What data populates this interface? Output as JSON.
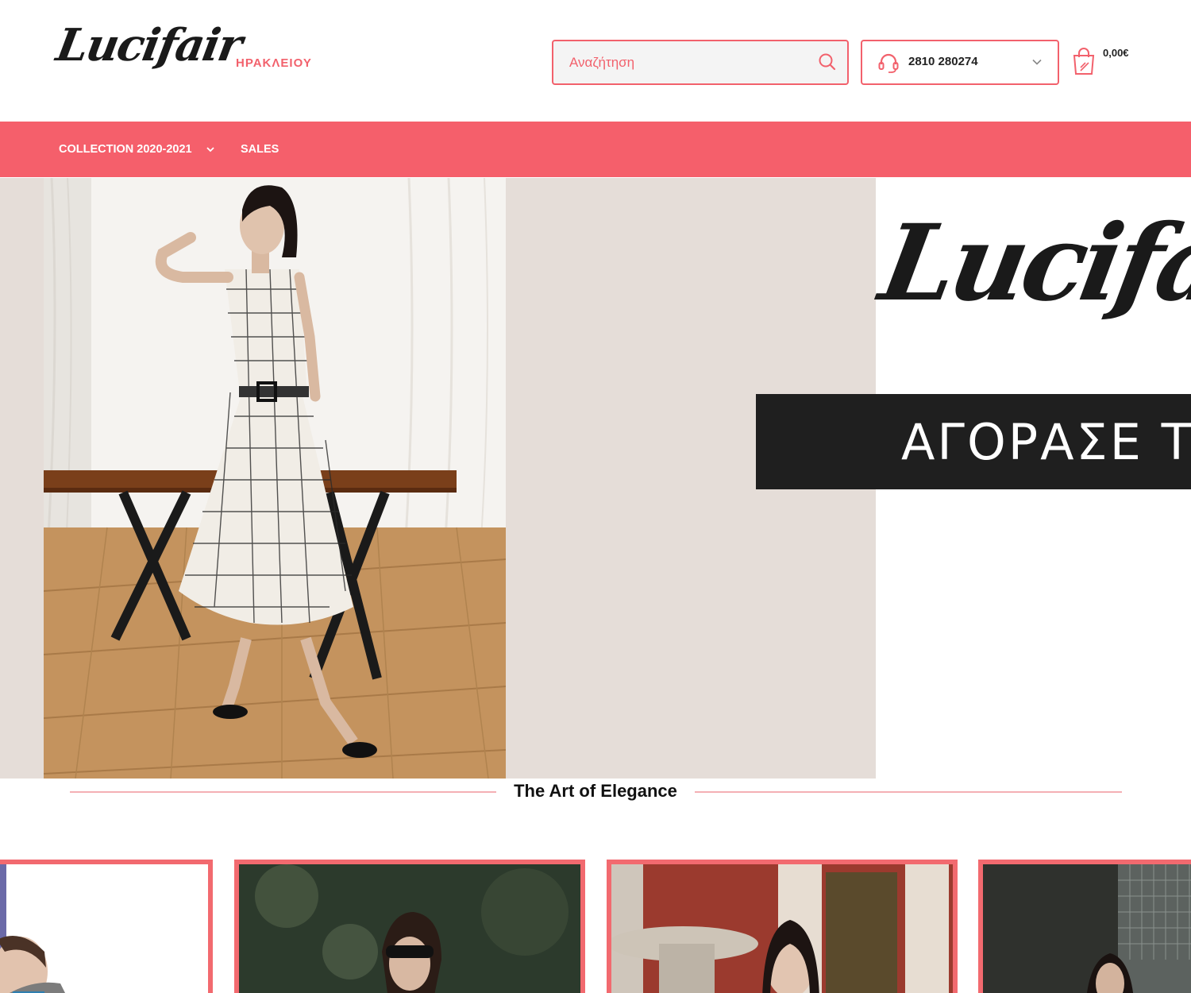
{
  "header": {
    "logo_text": "Lucifair",
    "logo_city": "ΗΡΑΚΛΕΙΟΥ",
    "search_placeholder": "Αναζήτηση",
    "phone": "2810 280274",
    "cart_total": "0,00€"
  },
  "nav": {
    "items": [
      {
        "label": "COLLECTION 2020-2021",
        "has_dropdown": true
      },
      {
        "label": "SALES",
        "has_dropdown": false
      }
    ]
  },
  "hero": {
    "brand_text": "Lucifair",
    "banner_text": "ΑΓΟΡΑΣΕ Τ"
  },
  "section": {
    "title": "The Art of Elegance"
  },
  "colors": {
    "accent": "#f55f6b",
    "card_border": "#f26a6f",
    "hero_bg": "#e5ddd8",
    "banner_bg": "#1f1f1f"
  },
  "icons": {
    "search": "search-icon",
    "phone": "headset-icon",
    "dropdown": "chevron-down-icon",
    "cart": "shopping-bag-icon"
  }
}
